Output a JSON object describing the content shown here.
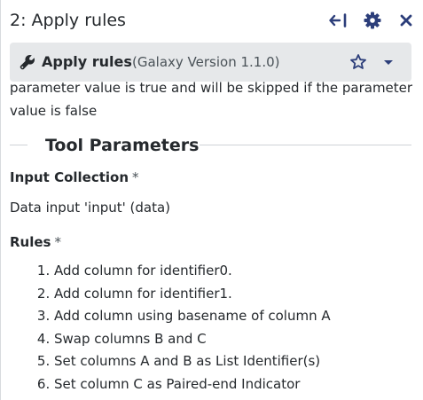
{
  "panel": {
    "title": "2: Apply rules"
  },
  "header_icons": [
    "collapse-to-left-icon",
    "gear-icon",
    "close-icon"
  ],
  "tool": {
    "name": "Apply rules",
    "version": "(Galaxy Version 1.1.0)"
  },
  "help": {
    "text": "parameter value is true and will be skipped if the parameter value is false"
  },
  "section": {
    "heading": "Tool Parameters"
  },
  "input_collection": {
    "label": "Input Collection",
    "required_mark": "*",
    "value": "Data input 'input' (data)"
  },
  "rules": {
    "label": "Rules",
    "required_mark": "*",
    "items": [
      "Add column for identifier0.",
      "Add column for identifier1.",
      "Add column using basename of column A",
      "Swap columns B and C",
      "Set columns A and B as List Identifier(s)",
      "Set column C as Paired-end Indicator"
    ]
  },
  "colors": {
    "text": "#25292d",
    "tool_bar_bg": "#e6e8ea",
    "icon_blue": "#2c3e7a",
    "divider": "#cfd3d7"
  }
}
